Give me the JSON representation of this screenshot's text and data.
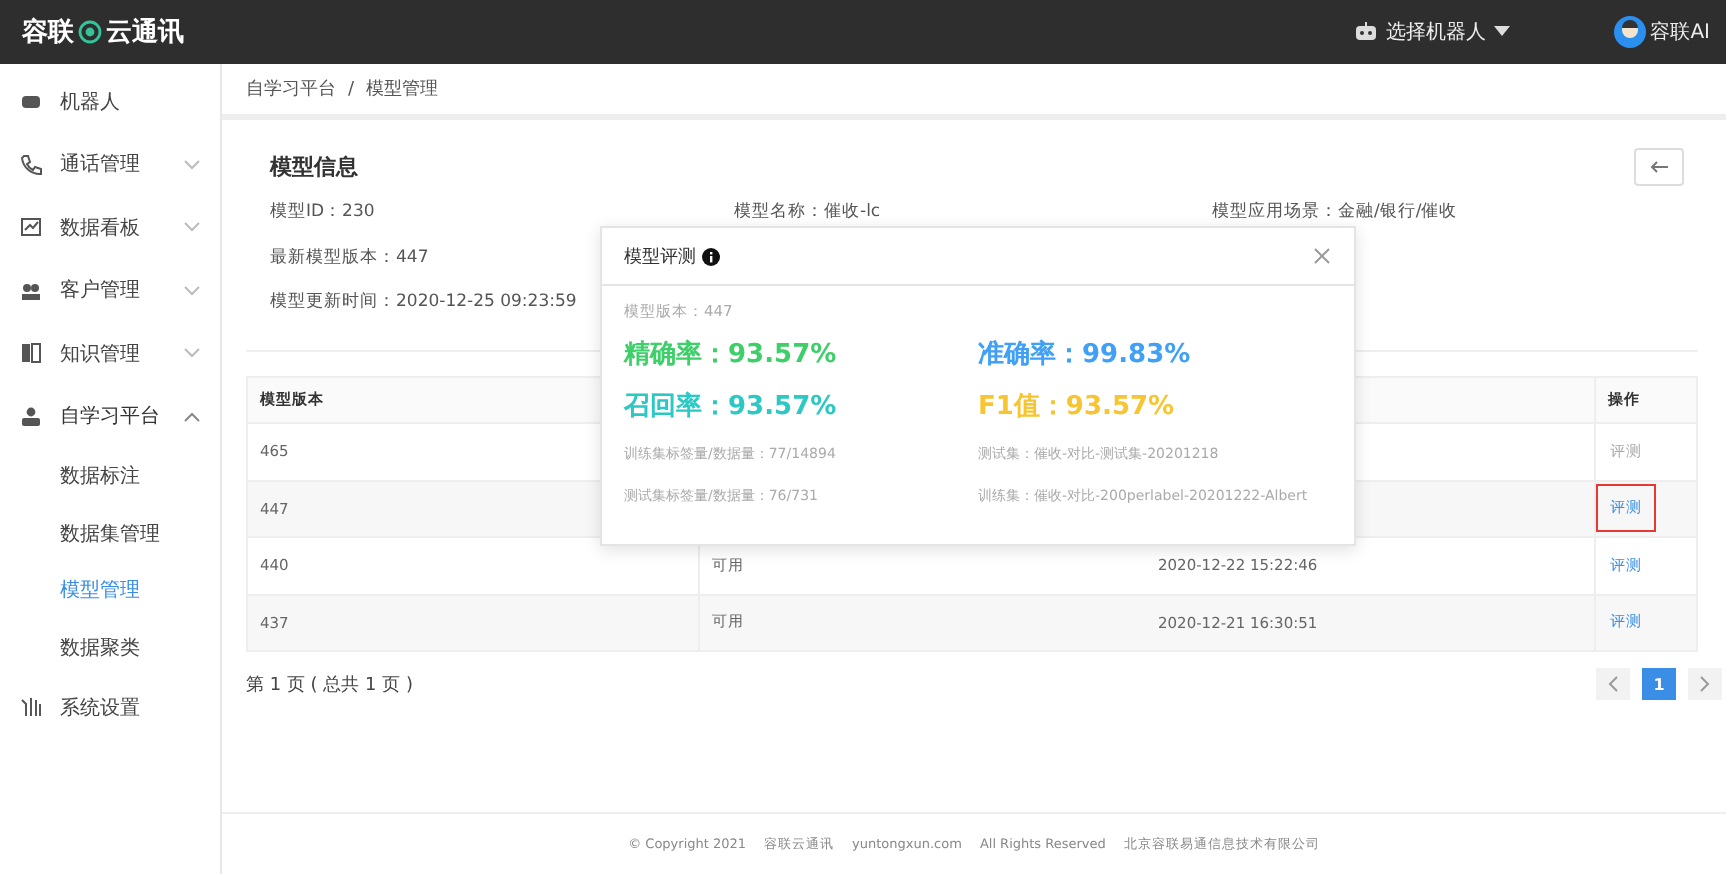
{
  "header": {
    "logo_left": "容联",
    "logo_right": "云通讯",
    "robot_select": "选择机器人",
    "user": "容联AI"
  },
  "sidebar": {
    "items": [
      {
        "label": "机器人"
      },
      {
        "label": "通话管理",
        "expanded": false
      },
      {
        "label": "数据看板",
        "expanded": false
      },
      {
        "label": "客户管理",
        "expanded": false
      },
      {
        "label": "知识管理",
        "expanded": false
      },
      {
        "label": "自学习平台",
        "expanded": true,
        "children": [
          {
            "label": "数据标注",
            "selected": false
          },
          {
            "label": "数据集管理",
            "selected": false
          },
          {
            "label": "模型管理",
            "selected": true
          },
          {
            "label": "数据聚类",
            "selected": false
          }
        ]
      },
      {
        "label": "系统设置"
      }
    ]
  },
  "breadcrumb": {
    "items": [
      "自学习平台",
      "模型管理"
    ],
    "separator": "/"
  },
  "model_info": {
    "title": "模型信息",
    "fields": [
      {
        "label": "模型ID：",
        "value": "230"
      },
      {
        "label": "模型名称：",
        "value": "催收-lc"
      },
      {
        "label": "模型应用场景：",
        "value": "金融/银行/催收"
      },
      {
        "label": "最新模型版本：",
        "value": "447"
      },
      {
        "label": "模型更新时间：",
        "value": "2020-12-25 09:23:59"
      }
    ]
  },
  "table": {
    "columns": [
      "模型版本",
      "操作"
    ],
    "rows": [
      {
        "version": "465",
        "action": "评测",
        "disabled": true,
        "highlighted": false
      },
      {
        "version": "447",
        "action": "评测",
        "disabled": false,
        "highlighted": true
      },
      {
        "version": "440",
        "status": "可用",
        "time": "2020-12-22 15:22:46",
        "action": "评测",
        "disabled": false,
        "highlighted": false
      },
      {
        "version": "437",
        "status": "可用",
        "time": "2020-12-21 16:30:51",
        "action": "评测",
        "disabled": false,
        "highlighted": false
      }
    ]
  },
  "pagination": {
    "summary": "第 1 页 ( 总共 1 页 )",
    "pages": [
      {
        "label": "1",
        "selected": true
      }
    ]
  },
  "modal": {
    "title": "模型评测",
    "version": "模型版本：447",
    "metrics": [
      {
        "label": "精确率：",
        "value": "93.57%",
        "color": "#3ecf6a"
      },
      {
        "label": "准确率：",
        "value": "99.83%",
        "color": "#3fa0f5"
      },
      {
        "label": "召回率：",
        "value": "93.57%",
        "color": "#2cc9c4"
      },
      {
        "label": "F1值：",
        "value": "93.57%",
        "color": "#f7c531"
      }
    ],
    "details": [
      "训练集标签量/数据量：77/14894",
      "测试集：催收-对比-测试集-20201218",
      "测试集标签量/数据量：76/731",
      "训练集：催收-对比-200perlabel-20201222-Albert"
    ]
  },
  "footer": [
    "© Copyright 2021",
    "容联云通讯",
    "yuntongxun.com",
    "All Rights Reserved",
    "北京容联易通信息技术有限公司"
  ]
}
